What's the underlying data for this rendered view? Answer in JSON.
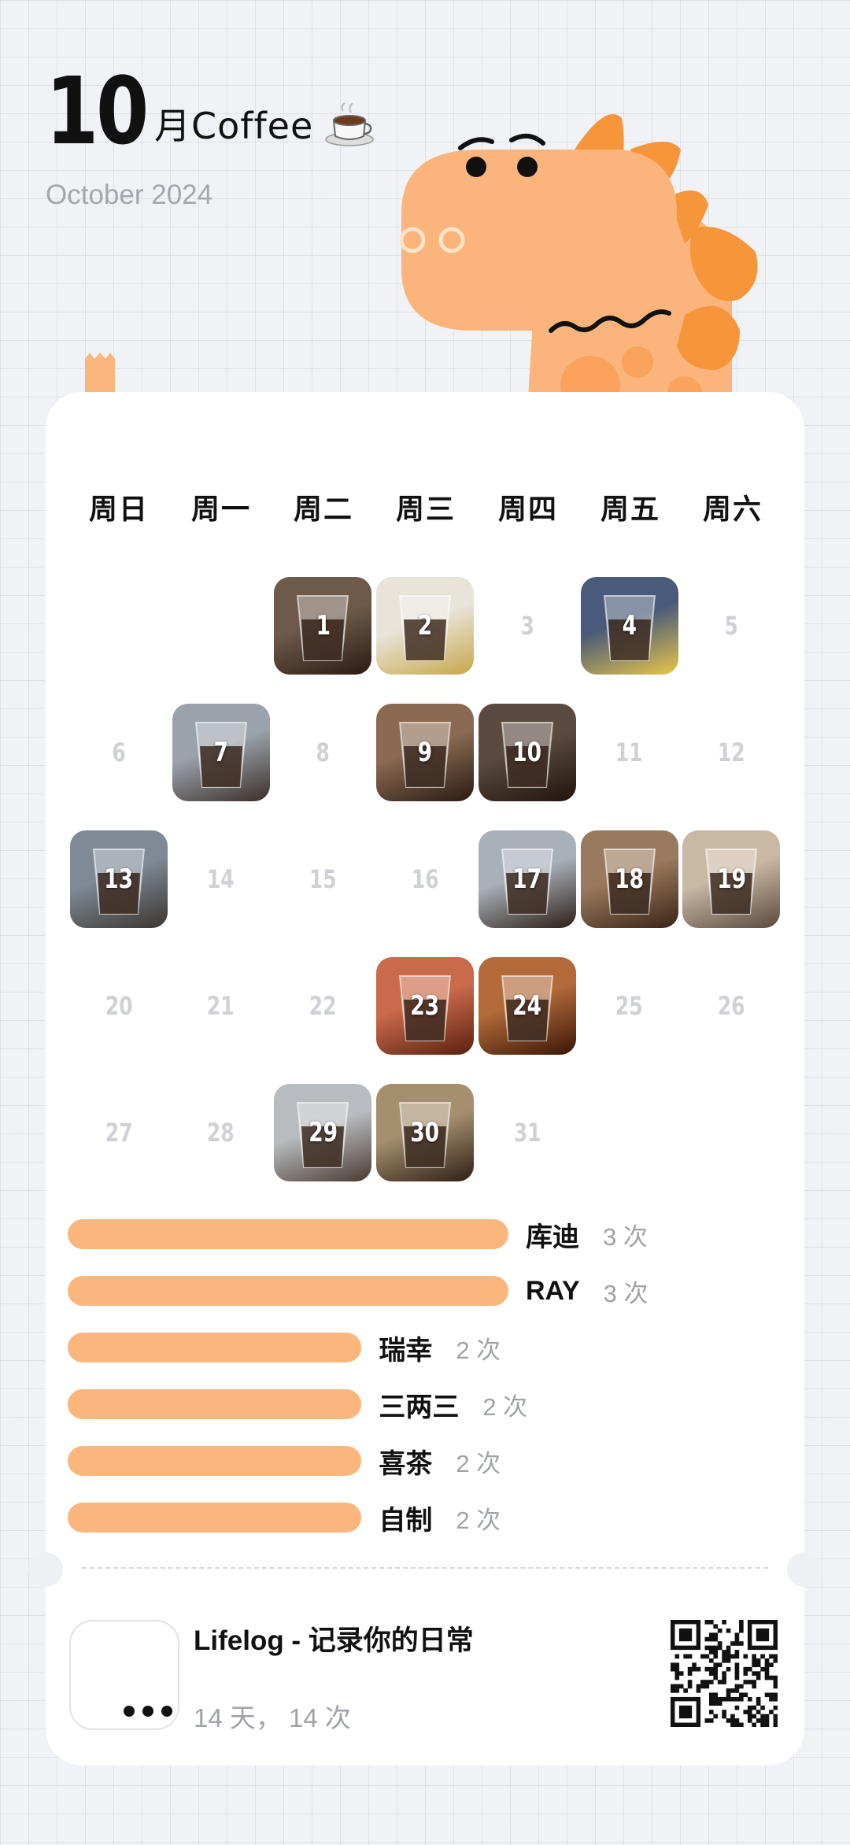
{
  "header": {
    "month_number": "10",
    "month_label": "月Coffee",
    "subtitle": "October 2024"
  },
  "icons": {
    "header_icon": "coffee-cup-icon",
    "mascot": "dinosaur-mascot-icon",
    "app": "more-dots-icon",
    "qr": "qr-code-icon"
  },
  "colors": {
    "accent": "#fab67d",
    "card": "#ffffff",
    "page_bg": "#f1f2f5",
    "muted_text": "#a3a6ad"
  },
  "calendar": {
    "weekdays": [
      "周日",
      "周一",
      "周二",
      "周三",
      "周四",
      "周五",
      "周六"
    ],
    "first_weekday": 2,
    "days": 31,
    "photo_days": [
      1,
      2,
      4,
      7,
      9,
      10,
      13,
      17,
      18,
      19,
      23,
      24,
      29,
      30
    ]
  },
  "stats": [
    {
      "name": "库迪",
      "count": 3,
      "count_label": "3 次"
    },
    {
      "name": "RAY",
      "count": 3,
      "count_label": "3 次"
    },
    {
      "name": "瑞幸",
      "count": 2,
      "count_label": "2 次"
    },
    {
      "name": "三两三",
      "count": 2,
      "count_label": "2 次"
    },
    {
      "name": "喜茶",
      "count": 2,
      "count_label": "2 次"
    },
    {
      "name": "自制",
      "count": 2,
      "count_label": "2 次"
    }
  ],
  "footer": {
    "app_title": "Lifelog - 记录你的日常",
    "stats": "14 天， 14 次"
  }
}
